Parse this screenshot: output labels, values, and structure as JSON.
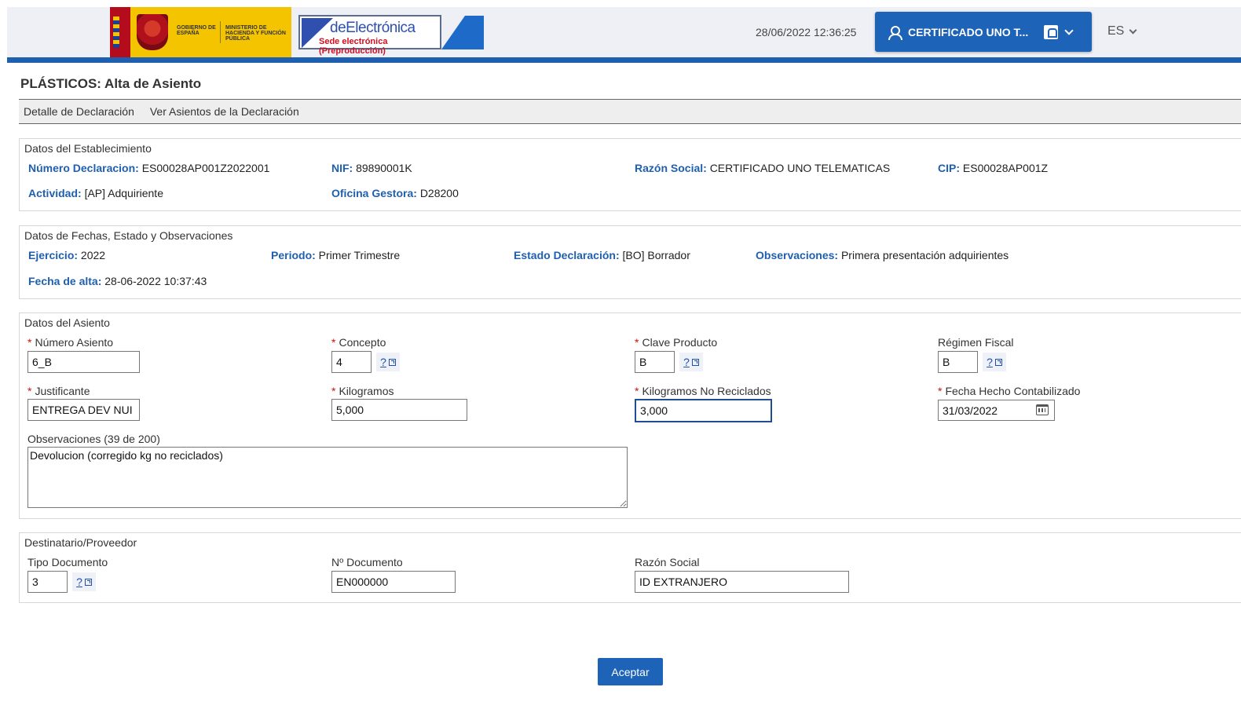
{
  "header": {
    "gov_text_1": "Gobierno de España",
    "gov_text_2": "Ministerio de Hacienda y Función Pública",
    "sede_title": "deElectrónica",
    "sede_sub": "Sede electrónica (Preproducción)",
    "datetime": "28/06/2022 12:36:25",
    "user_label": "CERTIFICADO UNO T...",
    "language": "ES"
  },
  "page": {
    "title": "PLÁSTICOS: Alta de Asiento",
    "tabs": [
      "Detalle de Declaración",
      "Ver Asientos de la Declaración"
    ]
  },
  "establecimiento": {
    "title": "Datos del Establecimiento",
    "numero_label": "Número Declaracion:",
    "numero_value": "ES00028AP001Z2022001",
    "nif_label": "NIF:",
    "nif_value": "89890001K",
    "razon_label": "Razón Social:",
    "razon_value": "CERTIFICADO UNO TELEMATICAS",
    "cip_label": "CIP:",
    "cip_value": "ES00028AP001Z",
    "actividad_label": "Actividad:",
    "actividad_value": "[AP] Adquiriente",
    "oficina_label": "Oficina Gestora:",
    "oficina_value": "D28200"
  },
  "fechas": {
    "title": "Datos de Fechas, Estado y Observaciones",
    "ejercicio_label": "Ejercicio:",
    "ejercicio_value": "2022",
    "periodo_label": "Periodo:",
    "periodo_value": "Primer Trimestre",
    "estado_label": "Estado Declaración:",
    "estado_value": "[BO] Borrador",
    "obs_label": "Observaciones:",
    "obs_value": "Primera presentación adquirientes",
    "alta_label": "Fecha de alta:",
    "alta_value": "28-06-2022 10:37:43"
  },
  "asiento": {
    "title": "Datos del Asiento",
    "required_mark": "*",
    "numero_label": "Número Asiento",
    "numero_value": "6_B",
    "concepto_label": "Concepto",
    "concepto_value": "4",
    "clave_label": "Clave Producto",
    "clave_value": "B",
    "regimen_label": "Régimen Fiscal",
    "regimen_value": "B",
    "justificante_label": "Justificante",
    "justificante_value": "ENTREGA DEV NUI",
    "kg_label": "Kilogramos",
    "kg_value": "5,000",
    "kgnr_label": "Kilogramos No Reciclados",
    "kgnr_value": "3,000",
    "fecha_label": "Fecha Hecho Contabilizado",
    "fecha_value": "31/03/2022",
    "obs_label": "Observaciones (39 de 200)",
    "obs_value": "Devolucion (corregido kg no reciclados)",
    "help_text": "?"
  },
  "destinatario": {
    "title": "Destinatario/Proveedor",
    "tipo_label": "Tipo Documento",
    "tipo_value": "3",
    "ndoc_label": "Nº Documento",
    "ndoc_value": "EN000000",
    "razon_label": "Razón Social",
    "razon_value": "ID EXTRANJERO"
  },
  "actions": {
    "accept_label": "Aceptar"
  }
}
